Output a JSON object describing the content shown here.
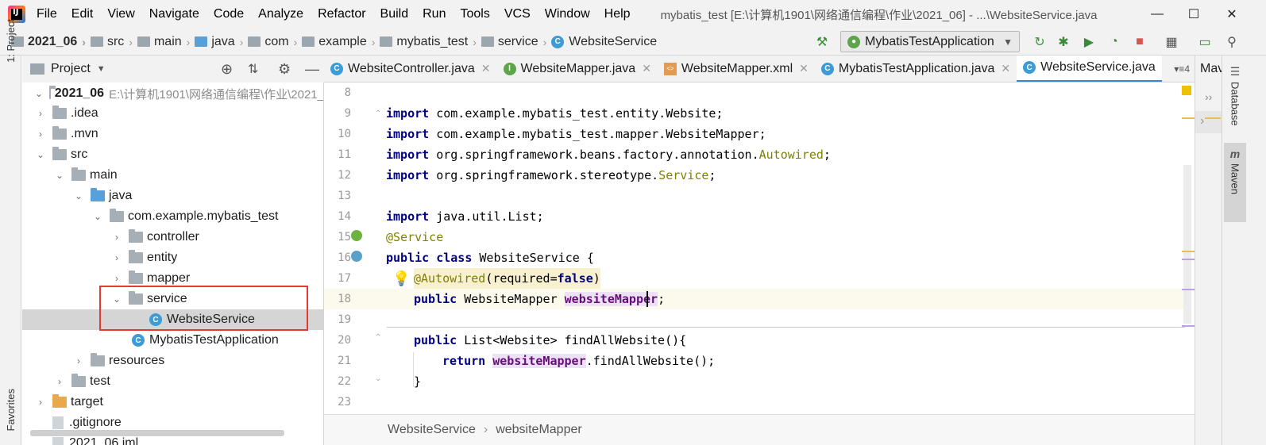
{
  "app": {
    "logo": "IJ"
  },
  "menu": [
    "File",
    "Edit",
    "View",
    "Navigate",
    "Code",
    "Analyze",
    "Refactor",
    "Build",
    "Run",
    "Tools",
    "VCS",
    "Window",
    "Help"
  ],
  "window_title": "mybatis_test [E:\\计算机1901\\网络通信编程\\作业\\2021_06] - ...\\WebsiteService.java",
  "window_buttons": {
    "minimize": "—",
    "maximize": "☐",
    "close": "✕"
  },
  "navbar": {
    "crumbs": [
      "2021_06",
      "src",
      "main",
      "java",
      "com",
      "example",
      "mybatis_test",
      "service",
      "WebsiteService"
    ],
    "run_config": "MybatisTestApplication"
  },
  "left_stripe": {
    "project_tab": "1: Project",
    "favorites_tab": "Favorites"
  },
  "project_panel": {
    "title": "Project"
  },
  "tree": [
    {
      "label": "2021_06",
      "path": "E:\\计算机1901\\网络通信编程\\作业\\2021_"
    },
    {
      "label": ".idea"
    },
    {
      "label": ".mvn"
    },
    {
      "label": "src"
    },
    {
      "label": "main"
    },
    {
      "label": "java"
    },
    {
      "label": "com.example.mybatis_test"
    },
    {
      "label": "controller"
    },
    {
      "label": "entity"
    },
    {
      "label": "mapper"
    },
    {
      "label": "service"
    },
    {
      "label": "WebsiteService"
    },
    {
      "label": "MybatisTestApplication"
    },
    {
      "label": "resources"
    },
    {
      "label": "test"
    },
    {
      "label": "target"
    },
    {
      "label": ".gitignore"
    },
    {
      "label": "2021_06.iml"
    }
  ],
  "editor_tabs": [
    "WebsiteController.java",
    "WebsiteMapper.java",
    "WebsiteMapper.xml",
    "MybatisTestApplication.java",
    "WebsiteService.java"
  ],
  "tab_overflow": "4",
  "second_editor_tab": "Mav",
  "right_stripe": {
    "database": "Database",
    "maven": "Maven"
  },
  "line_numbers": [
    "8",
    "9",
    "10",
    "11",
    "12",
    "13",
    "14",
    "15",
    "16",
    "17",
    "18",
    "19",
    "20",
    "21",
    "22",
    "23"
  ],
  "code": {
    "l9_pkg": " com.example.mybatis_test.entity.Website;",
    "l10_pkg": " com.example.mybatis_test.mapper.WebsiteMapper;",
    "l11_pkg": " org.springframework.beans.factory.annotation.",
    "l11_ann": "Autowired",
    "l12_pkg": " org.springframework.stereotype.",
    "l12_ann": "Service",
    "l14_pkg": " java.util.List;",
    "kw_import": "import",
    "l15": "@Service",
    "kw_public": "public",
    "kw_class": "class",
    "l16_name": " WebsiteService {",
    "l17_ann": "@Autowired",
    "l17_rest": "(required=",
    "kw_false": "false",
    "l17_end": ")",
    "l18_type": " WebsiteMapper ",
    "field": "websiteMapper",
    "semicolon": ";",
    "l20_sig": " List<Website> findAllWebsite(){",
    "kw_return": "return",
    "l21_call": ".findAllWebsite();",
    "l22": "}"
  },
  "bottom_breadcrumb": [
    "WebsiteService",
    "websiteMapper"
  ]
}
